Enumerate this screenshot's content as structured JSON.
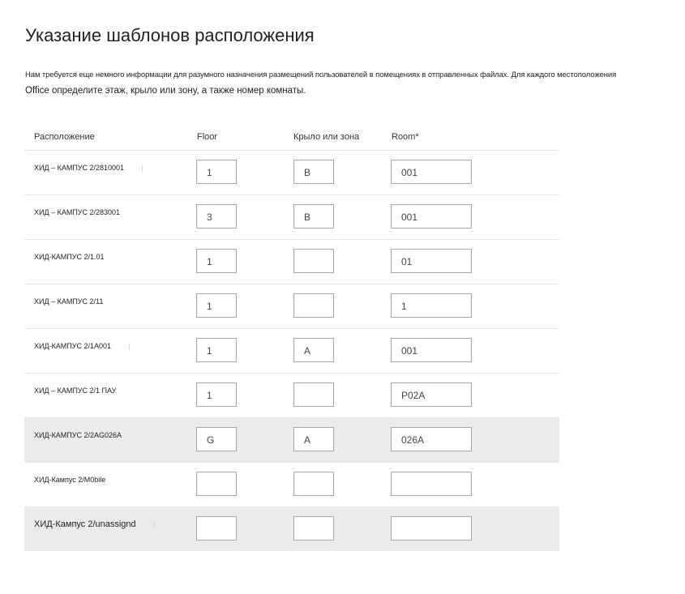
{
  "page": {
    "title": "Указание шаблонов расположения",
    "description_line1": "Нам требуется еще немного информации для разумного назначения размещений пользователей в помещениях в отправленных файлах. Для каждого местоположения",
    "description_line2": "Office определите этаж, крыло или зону, а также номер комнаты."
  },
  "table": {
    "headers": {
      "location": "Расположение",
      "floor": "Floor",
      "wing": "Крыло или зона",
      "room": "Room*"
    },
    "rows": [
      {
        "location": "ХИД – КАМПУС 2/2810001",
        "floor": "1",
        "wing": "B",
        "room": "001"
      },
      {
        "location": "ХИД – КАМПУС 2/283001",
        "floor": "3",
        "wing": "B",
        "room": "001"
      },
      {
        "location": "ХИД-КАМПУС 2/1.01",
        "floor": "1",
        "wing": "",
        "room": "01"
      },
      {
        "location": "ХИД – КАМПУС 2/11",
        "floor": "1",
        "wing": "",
        "room": "1"
      },
      {
        "location": "ХИД-КАМПУС 2/1A001",
        "floor": "1",
        "wing": "A",
        "room": "001"
      },
      {
        "location": "ХИД – КАМПУС 2/1 ПАУ",
        "floor": "1",
        "wing": "",
        "room": "P02A"
      },
      {
        "location": "ХИД-КАМПУС 2/2AG026A",
        "floor": "G",
        "wing": "A",
        "room": "026A"
      },
      {
        "location": "ХИД-Кампус 2/M0bile",
        "floor": "",
        "wing": "",
        "room": ""
      },
      {
        "location": "ХИД-Кампус 2/unassignd",
        "floor": "",
        "wing": "",
        "room": ""
      }
    ]
  }
}
